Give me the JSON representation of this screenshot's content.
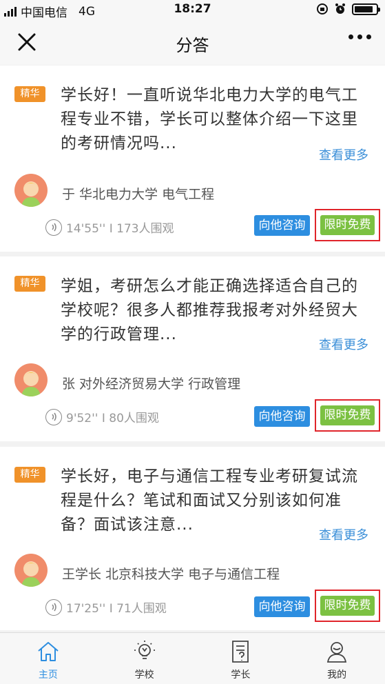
{
  "status_bar": {
    "carrier": "中国电信",
    "network": "4G",
    "time": "18:27"
  },
  "nav": {
    "title": "分答"
  },
  "cards": [
    {
      "badge": "精华",
      "question": "学长好！一直听说华北电力大学的电气工程专业不错，学长可以整体介绍一下这里的考研情况吗...",
      "more": "查看更多",
      "author": "于 华北电力大学 电气工程",
      "stats": "14'55'' I 173人围观",
      "consult": "向他咨询",
      "free": "限时免费"
    },
    {
      "badge": "精华",
      "question": "学姐，考研怎么才能正确选择适合自己的学校呢？很多人都推荐我报考对外经贸大学的行政管理...",
      "more": "查看更多",
      "author": "张 对外经济贸易大学 行政管理",
      "stats": "9'52'' I 80人围观",
      "consult": "向他咨询",
      "free": "限时免费"
    },
    {
      "badge": "精华",
      "question": "学长好，电子与通信工程专业考研复试流程是什么？笔试和面试又分别该如何准备？面试该注意...",
      "more": "查看更多",
      "author": "王学长 北京科技大学 电子与通信工程",
      "stats": "17'25'' I 71人围观",
      "consult": "向他咨询",
      "free": "限时免费"
    }
  ],
  "tabs": [
    {
      "label": "主页",
      "icon": "home-icon",
      "active": true
    },
    {
      "label": "学校",
      "icon": "lightbulb-icon",
      "active": false
    },
    {
      "label": "学长",
      "icon": "question-doc-icon",
      "active": false
    },
    {
      "label": "我的",
      "icon": "user-icon",
      "active": false
    }
  ],
  "colors": {
    "accent": "#2d8ee0",
    "badge": "#f0922a",
    "free": "#7cc142",
    "highlight_border": "#e0242a"
  }
}
